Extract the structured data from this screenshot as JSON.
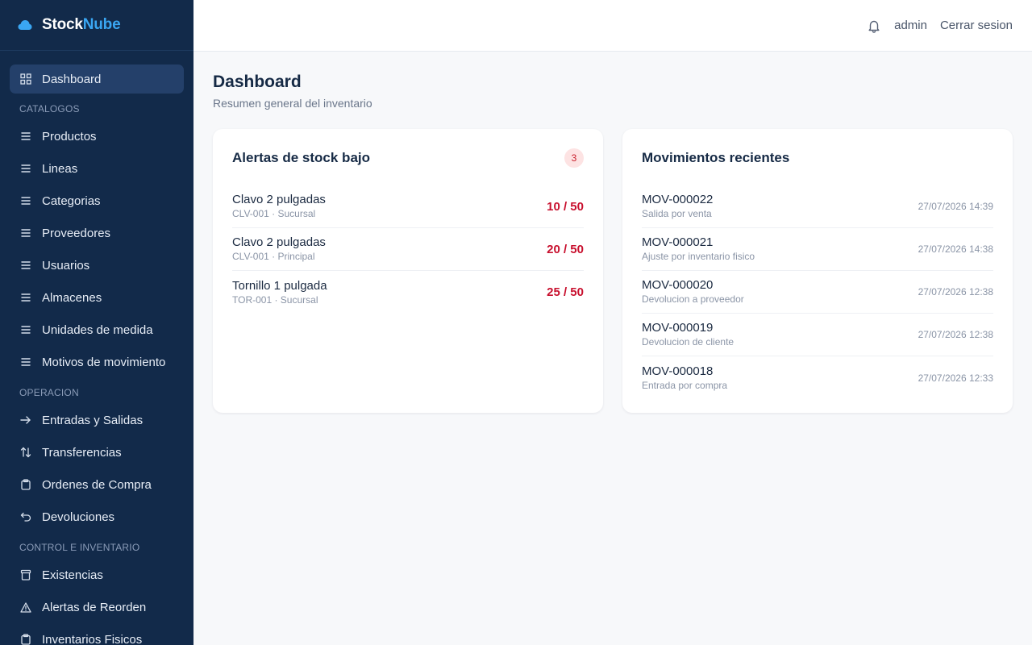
{
  "brand": {
    "part1": "Stock",
    "part2": "Nube"
  },
  "sidebar": {
    "dashboard": "Dashboard",
    "sections": {
      "catalogos": "CATALOGOS",
      "operacion": "OPERACION",
      "control": "CONTROL E INVENTARIO"
    },
    "catalogos": [
      {
        "label": "Productos",
        "icon": "menu-icon"
      },
      {
        "label": "Lineas",
        "icon": "menu-icon"
      },
      {
        "label": "Categorias",
        "icon": "menu-icon"
      },
      {
        "label": "Proveedores",
        "icon": "menu-icon"
      },
      {
        "label": "Usuarios",
        "icon": "menu-icon"
      },
      {
        "label": "Almacenes",
        "icon": "menu-icon"
      },
      {
        "label": "Unidades de medida",
        "icon": "menu-icon"
      },
      {
        "label": "Motivos de movimiento",
        "icon": "menu-icon"
      }
    ],
    "operacion": [
      {
        "label": "Entradas y Salidas",
        "icon": "arrow-right-icon"
      },
      {
        "label": "Transferencias",
        "icon": "arrows-up-down-icon"
      },
      {
        "label": "Ordenes de Compra",
        "icon": "clipboard-icon"
      },
      {
        "label": "Devoluciones",
        "icon": "undo-icon"
      }
    ],
    "control": [
      {
        "label": "Existencias",
        "icon": "archive-icon"
      },
      {
        "label": "Alertas de Reorden",
        "icon": "warning-icon"
      },
      {
        "label": "Inventarios Fisicos",
        "icon": "clipboard-icon"
      }
    ]
  },
  "topbar": {
    "user": "admin",
    "logout": "Cerrar sesion"
  },
  "page": {
    "title": "Dashboard",
    "subtitle": "Resumen general del inventario"
  },
  "alerts": {
    "title": "Alertas de stock bajo",
    "count": "3",
    "items": [
      {
        "name": "Clavo 2 pulgadas",
        "detail": "CLV-001 · Sucursal",
        "value": "10 / 50"
      },
      {
        "name": "Clavo 2 pulgadas",
        "detail": "CLV-001 · Principal",
        "value": "20 / 50"
      },
      {
        "name": "Tornillo 1 pulgada",
        "detail": "TOR-001 · Sucursal",
        "value": "25 / 50"
      }
    ]
  },
  "movements": {
    "title": "Movimientos recientes",
    "items": [
      {
        "code": "MOV-000022",
        "reason": "Salida por venta",
        "date": "27/07/2026 14:39"
      },
      {
        "code": "MOV-000021",
        "reason": "Ajuste por inventario fisico",
        "date": "27/07/2026 14:38"
      },
      {
        "code": "MOV-000020",
        "reason": "Devolucion a proveedor",
        "date": "27/07/2026 12:38"
      },
      {
        "code": "MOV-000019",
        "reason": "Devolucion de cliente",
        "date": "27/07/2026 12:38"
      },
      {
        "code": "MOV-000018",
        "reason": "Entrada por compra",
        "date": "27/07/2026 12:33"
      }
    ]
  },
  "colors": {
    "sidebar": "#122a4a",
    "active": "#24406a",
    "brand_accent": "#3aa6f2",
    "alert_red": "#c8102e",
    "badge_bg": "#fde3e3"
  }
}
